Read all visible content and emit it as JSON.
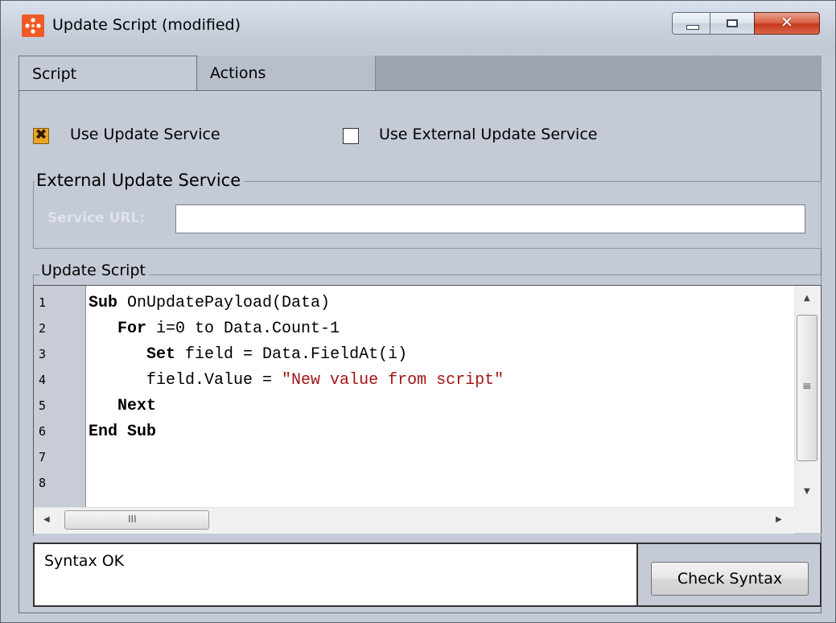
{
  "window": {
    "title": "Update Script (modified)",
    "close_glyph": "✕"
  },
  "tabs": [
    {
      "label": "Script",
      "active": true
    },
    {
      "label": "Actions",
      "active": false
    }
  ],
  "options": {
    "use_update_service": {
      "label": "Use Update Service",
      "checked": true,
      "mark": "✖"
    },
    "use_external_update_service": {
      "label": "Use External Update Service",
      "checked": false
    }
  },
  "external_group": {
    "title": "External Update Service",
    "service_url_label": "Service URL:",
    "service_url_value": ""
  },
  "script_group": {
    "title": "Update Script",
    "line_numbers": [
      "1",
      "2",
      "3",
      "4",
      "5",
      "6",
      "7",
      "8"
    ],
    "code": [
      {
        "kw": "Sub",
        "rest": " OnUpdatePayload(Data)",
        "str": ""
      },
      {
        "kw": "   For",
        "rest": " i=0 to Data.Count-1",
        "str": ""
      },
      {
        "kw": "      Set",
        "rest": " field = Data.FieldAt(i)",
        "str": ""
      },
      {
        "kw": "",
        "rest": "      field.Value = ",
        "str": "\"New value from script\""
      },
      {
        "kw": "   Next",
        "rest": "",
        "str": ""
      },
      {
        "kw": "End Sub",
        "rest": "",
        "str": ""
      }
    ],
    "hscroll_grip": "III",
    "vscroll_grip": "≡"
  },
  "status": {
    "text": "Syntax OK",
    "check_button": "Check Syntax"
  },
  "colors": {
    "accent": "#f05a26",
    "check_fill": "#e9a528",
    "string_literal": "#a31515"
  }
}
